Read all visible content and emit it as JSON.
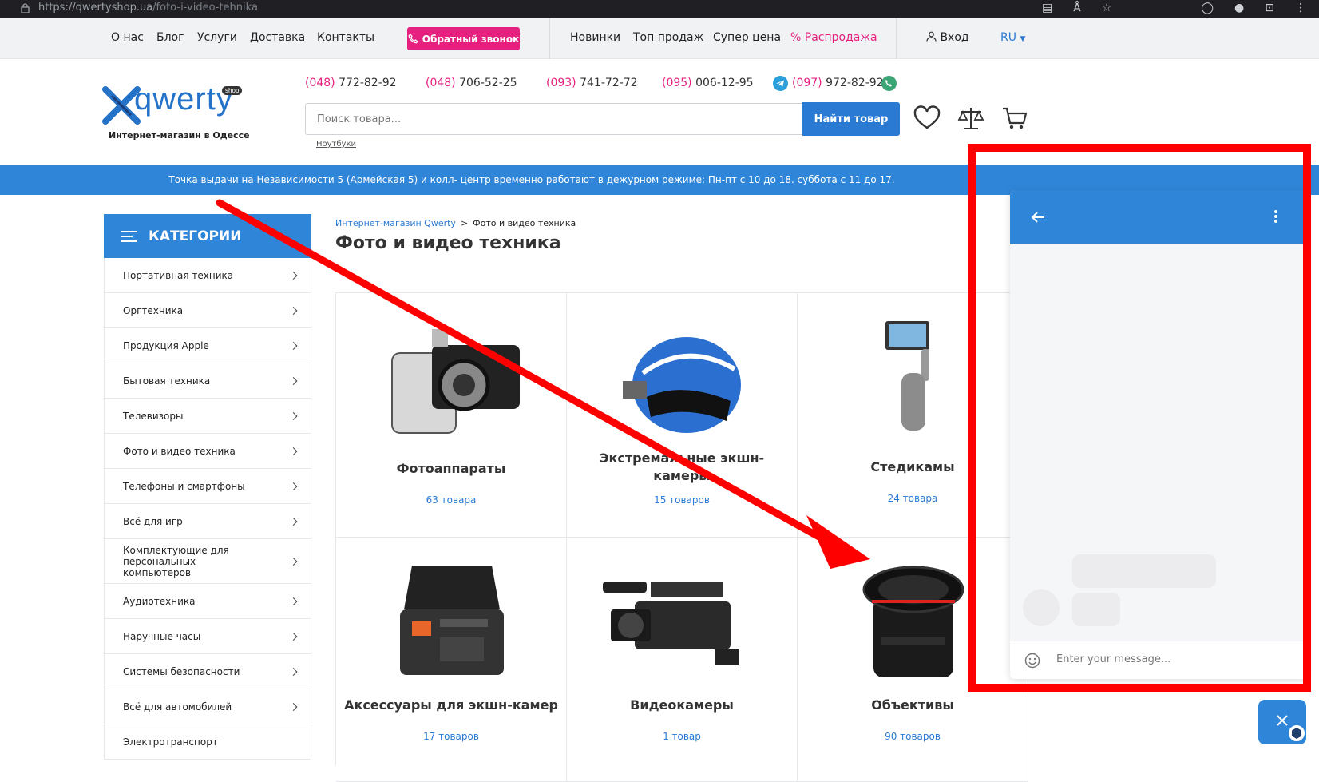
{
  "browser": {
    "url_host": "https://qwertyshop.ua",
    "url_path": "/foto-i-video-tehnika"
  },
  "topnav": {
    "left_links": [
      "О нас",
      "Блог",
      "Услуги",
      "Доставка",
      "Контакты"
    ],
    "callback_label": "Обратный звонок",
    "right_links": [
      "Новинки",
      "Топ продаж",
      "Супер цена"
    ],
    "sale_label": "Распродажа",
    "login_label": "Вход",
    "lang_label": "RU"
  },
  "header": {
    "logo_word": "qwerty",
    "logo_badge": "shop",
    "tagline": "Интернет-магазин в Одессе",
    "phones": [
      {
        "code": "(048)",
        "number": "772-82-92"
      },
      {
        "code": "(048)",
        "number": "706-52-25"
      },
      {
        "code": "(093)",
        "number": "741-72-72"
      },
      {
        "code": "(095)",
        "number": "006-12-95"
      },
      {
        "code": "(097)",
        "number": "972-82-92"
      }
    ],
    "search_placeholder": "Поиск товара...",
    "search_button": "Найти товар",
    "search_hint": "Ноутбуки"
  },
  "banner": {
    "text": "Точка выдачи на Независимости 5 (Армейская 5) и колл- центр временно работают в дежурном режиме: Пн-пт с 10 до 18. суббота с 11 до 17."
  },
  "sidebar": {
    "title": "КАТЕГОРИИ",
    "items": [
      "Портативная техника",
      "Оргтехника",
      "Продукция Apple",
      "Бытовая техника",
      "Телевизоры",
      "Фото и видео техника",
      "Телефоны и смартфоны",
      "Всё для игр",
      "Комплектующие для персональных компьютеров",
      "Аудиотехника",
      "Наручные часы",
      "Системы безопасности",
      "Всё для автомобилей",
      "Электротранспорт"
    ]
  },
  "breadcrumb": {
    "home": "Интернет-магазин Qwerty",
    "current": "Фото и видео техника"
  },
  "page_title": "Фото и видео техника",
  "categories": [
    {
      "name": "Фотоаппараты",
      "count": "63 товара"
    },
    {
      "name": "Экстремальные экшн-камеры",
      "count": "15 товаров"
    },
    {
      "name": "Стедикамы",
      "count": "24 товара"
    },
    {
      "name": "Аксессуары для экшн-камер",
      "count": "17 товаров"
    },
    {
      "name": "Видеокамеры",
      "count": "1 товар"
    },
    {
      "name": "Объективы",
      "count": "90 товаров"
    }
  ],
  "chat": {
    "message_placeholder": "Enter your message..."
  },
  "colors": {
    "accent_blue": "#2f86d9",
    "pink": "#e6207f",
    "annotation_red": "#ff0000"
  }
}
